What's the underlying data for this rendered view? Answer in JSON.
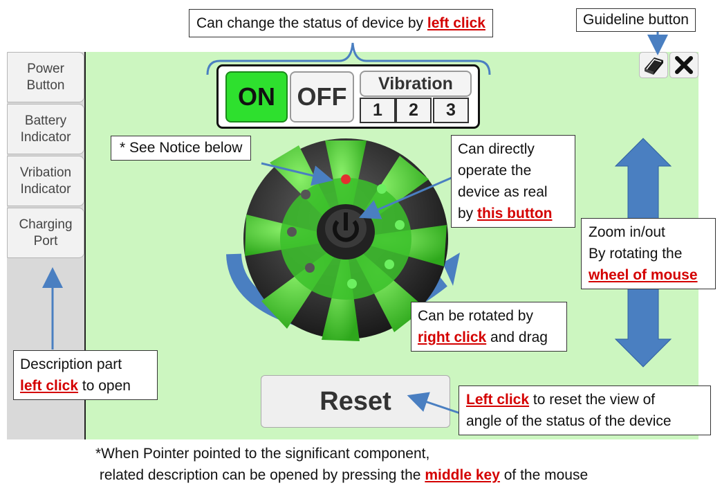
{
  "sidebar": {
    "tabs": [
      {
        "label": "Power\nButton"
      },
      {
        "label": "Battery\nIndicator"
      },
      {
        "label": "Vribation\nIndicator"
      },
      {
        "label": "Charging\nPort"
      }
    ]
  },
  "status_panel": {
    "on_label": "ON",
    "off_label": "OFF",
    "vibration_label": "Vibration",
    "vibration_levels": [
      "1",
      "2",
      "3"
    ]
  },
  "reset_label": "Reset",
  "icons": {
    "guide": "book-icon",
    "close": "close-x-icon"
  },
  "callouts": {
    "status": {
      "text": "Can change the status of device by ",
      "highlight": "left click"
    },
    "guideline": {
      "text": "Guideline button"
    },
    "notice_ref": {
      "text": "* See Notice below"
    },
    "operate": {
      "line1": "Can directly",
      "line2": "operate the",
      "line3": "device as real",
      "line4_prefix": "by ",
      "highlight": "this button"
    },
    "zoom": {
      "line1": "Zoom in/out",
      "line2": "By rotating the",
      "highlight": "wheel of mouse"
    },
    "rotate": {
      "line1": "Can be rotated by",
      "highlight": "right click",
      "suffix": " and drag"
    },
    "description": {
      "line1": "Description part",
      "highlight": "left click",
      "suffix": " to open"
    },
    "reset": {
      "highlight": "Left click",
      "line1_suffix": " to reset the view of",
      "line2": "angle of the status of the device"
    }
  },
  "notice": {
    "line1": "*When Pointer pointed to the significant component,",
    "line2_prefix": " related description can be opened by pressing the ",
    "highlight": "middle key",
    "line2_suffix": " of the mouse"
  },
  "colors": {
    "scene_bg": "#ccf6c0",
    "on_active": "#2ee02e",
    "highlight_red": "#d40000",
    "arrow_blue": "#4a7fc1"
  }
}
